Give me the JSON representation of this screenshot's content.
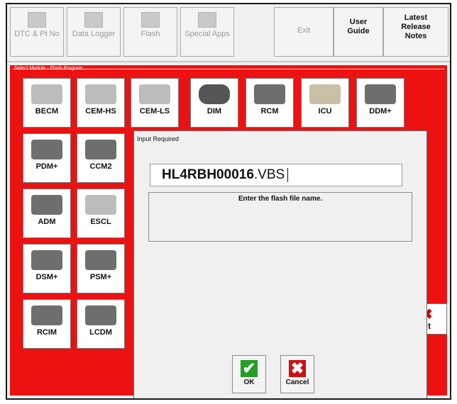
{
  "toolbar": {
    "dtc_label": "DTC & Pt No",
    "datalogger_label": "Data Logger",
    "flash_label": "Flash",
    "special_label": "Special Apps",
    "exit_label": "Exit",
    "userguide_label": "User Guide",
    "latest_label": "Latest Release Notes"
  },
  "panel": {
    "title": "Select Module - Flash Program",
    "exit_label": "xit"
  },
  "modules": [
    {
      "label": "BECM"
    },
    {
      "label": "CEM-HS"
    },
    {
      "label": "CEM-LS"
    },
    {
      "label": "DIM"
    },
    {
      "label": "RCM"
    },
    {
      "label": "ICU"
    },
    {
      "label": "DDM+"
    },
    {
      "label": "PDM+"
    },
    {
      "label": "CCM2"
    },
    {
      "label": "ADM"
    },
    {
      "label": "ESCL"
    },
    {
      "label": "DSM+"
    },
    {
      "label": "PSM+"
    },
    {
      "label": "RCIM"
    },
    {
      "label": "LCDM"
    }
  ],
  "dialog": {
    "title": "Input Required",
    "input_bold": "HL4RBH00016",
    "input_rest": ".VBS",
    "message": "Enter the flash file name.",
    "ok_label": "OK",
    "cancel_label": "Cancel"
  },
  "colors": {
    "panel_red": "#ee1111",
    "ok_green": "#22a022",
    "cancel_red": "#cc1111"
  }
}
